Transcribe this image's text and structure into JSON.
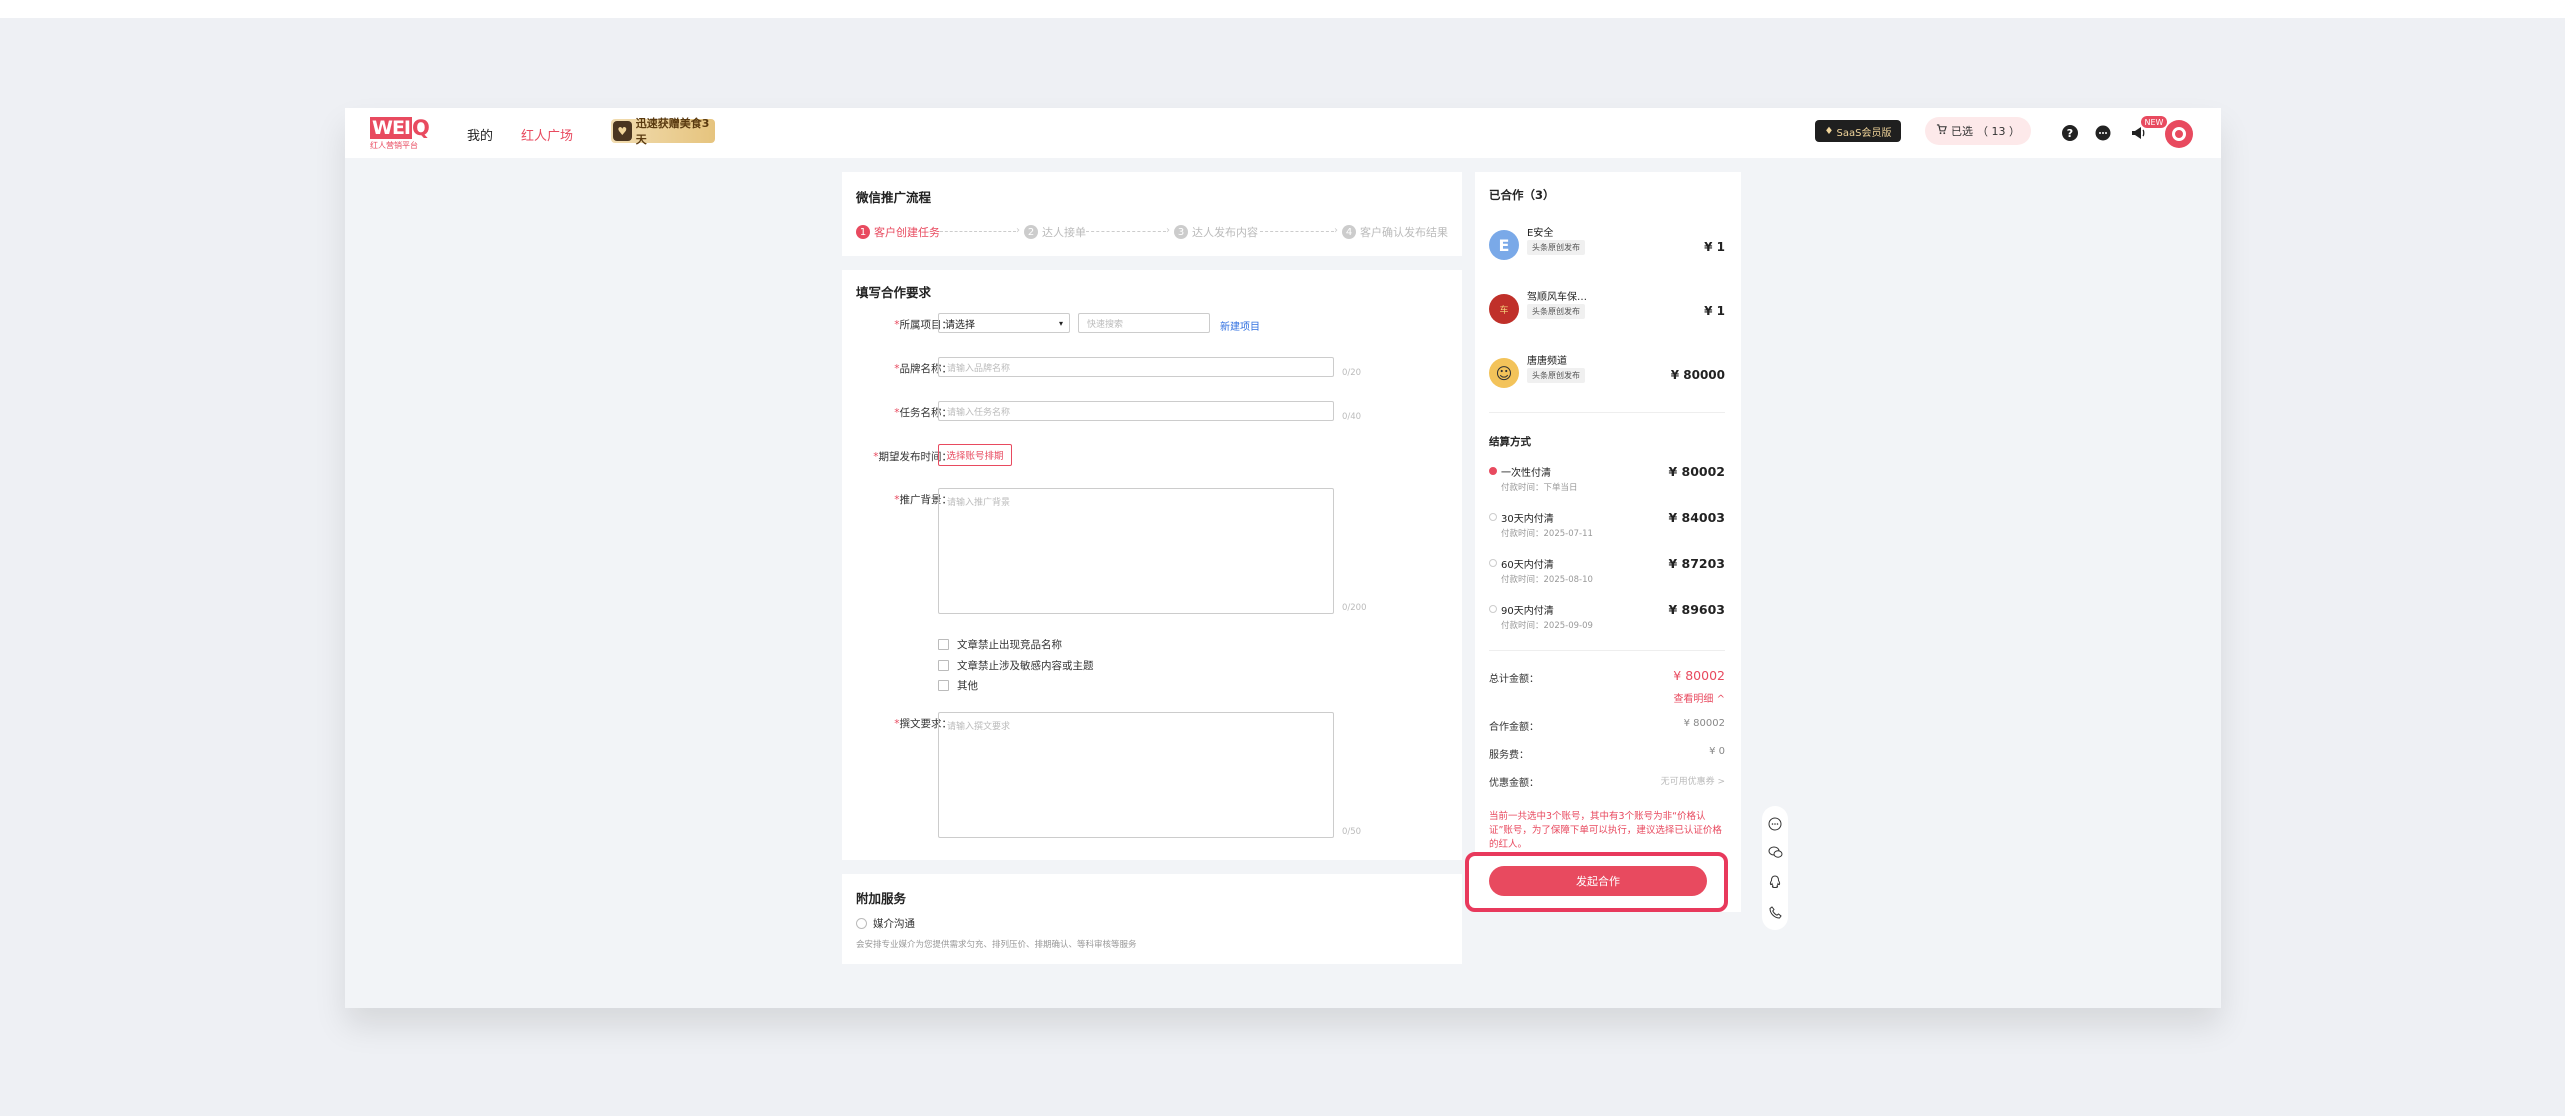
{
  "colors": {
    "accent": "#e84a5f",
    "link": "#2f6fe0"
  },
  "nav": {
    "logo_text": "WEI",
    "logo_letter": "Q",
    "logo_sub": "红人营销平台",
    "mine": "我的",
    "square": "红人广场",
    "promo": "迅速获赠美食3天",
    "saas": "SaaS会员版",
    "cart_label": "已选",
    "cart_count": "（ 13 ）",
    "new_badge": "NEW"
  },
  "flow": {
    "title": "微信推广流程",
    "steps": [
      {
        "num": "1",
        "label": "客户创建任务"
      },
      {
        "num": "2",
        "label": "达人接单"
      },
      {
        "num": "3",
        "label": "达人发布内容"
      },
      {
        "num": "4",
        "label": "客户确认发布结果"
      }
    ]
  },
  "form": {
    "title": "填写合作要求",
    "project_label": "所属项目：",
    "project_select": "请选择",
    "project_search": "快速搜索",
    "new_project": "新建项目",
    "brand_label": "品牌名称：",
    "brand_placeholder": "请输入品牌名称",
    "brand_counter": "0/20",
    "task_label": "任务名称：",
    "task_placeholder": "请输入任务名称",
    "task_counter": "0/40",
    "time_label": "期望发布时间：",
    "time_button": "选择账号排期",
    "bg_label": "推广背景：",
    "bg_placeholder": "请输入推广背景",
    "bg_counter": "0/200",
    "checks": [
      "文章禁止出现竞品名称",
      "文章禁止涉及敏感内容或主题",
      "其他"
    ],
    "write_label": "撰文要求：",
    "write_placeholder": "请输入撰文要求",
    "write_counter": "0/50"
  },
  "extra": {
    "title": "附加服务",
    "option": "媒介沟通",
    "desc": "会安排专业媒介为您提供需求匀充、排列压价、排期确认、等科审核等服务"
  },
  "cooperated": {
    "title": "已合作（3）",
    "items": [
      {
        "name": "E安全",
        "tag": "头条原创发布",
        "price": "¥ 1"
      },
      {
        "name": "驾顺风车保…",
        "tag": "头条原创发布",
        "price": "¥ 1"
      },
      {
        "name": "唐唐频道",
        "tag": "头条原创发布",
        "price": "¥ 80000"
      }
    ]
  },
  "settlement": {
    "title": "结算方式",
    "options": [
      {
        "name": "一次性付清",
        "time": "付款时间：下单当日",
        "amount": "¥ 80002",
        "checked": true
      },
      {
        "name": "30天内付清",
        "time": "付款时间：2025-07-11",
        "amount": "¥ 84003",
        "checked": false
      },
      {
        "name": "60天内付清",
        "time": "付款时间：2025-08-10",
        "amount": "¥ 87203",
        "checked": false
      },
      {
        "name": "90天内付清",
        "time": "付款时间：2025-09-09",
        "amount": "¥ 89603",
        "checked": false
      }
    ],
    "total_label": "总计金额：",
    "total_value": "¥ 80002",
    "detail_link": "查看明细 ^",
    "coop_label": "合作金额：",
    "coop_value": "¥ 80002",
    "fee_label": "服务费：",
    "fee_value": "¥ 0",
    "discount_label": "优惠金额：",
    "discount_value": "无可用优惠券 >",
    "warning": "当前一共选中3个账号，其中有3个账号为非“价格认证”账号，为了保障下单可以执行，建议选择已认证价格的红人。",
    "submit": "发起合作"
  }
}
